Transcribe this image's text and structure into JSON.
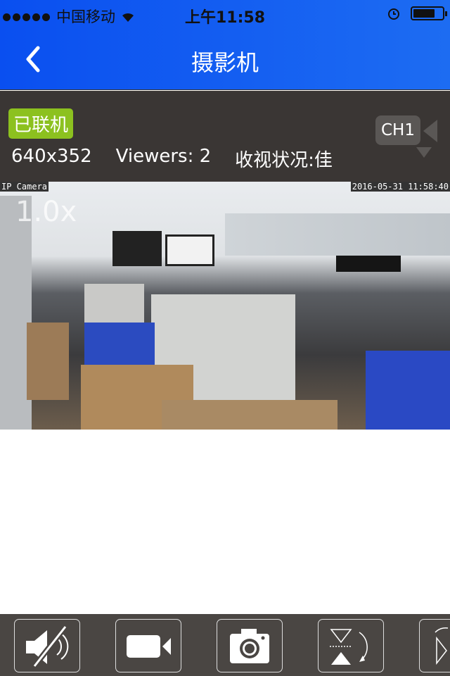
{
  "status_bar": {
    "carrier": "中国移动",
    "time": "上午11:58",
    "battery_level": 0.75
  },
  "nav": {
    "title": "摄影机"
  },
  "info": {
    "status_badge": "已联机",
    "resolution": "640x352",
    "viewers": "Viewers: 2",
    "quality": "收视状况:佳",
    "channel": "CH1"
  },
  "video": {
    "label": "IP Camera",
    "timestamp": "2016-05-31 11:58:40",
    "zoom": "1.0x"
  },
  "toolbar": {
    "buttons": [
      "mute",
      "record",
      "snapshot",
      "flip",
      "next"
    ]
  },
  "colors": {
    "nav": "#0a4ff0",
    "badge": "#8cc11f",
    "panel": "#3a3634",
    "toolbar": "#4a4643"
  }
}
